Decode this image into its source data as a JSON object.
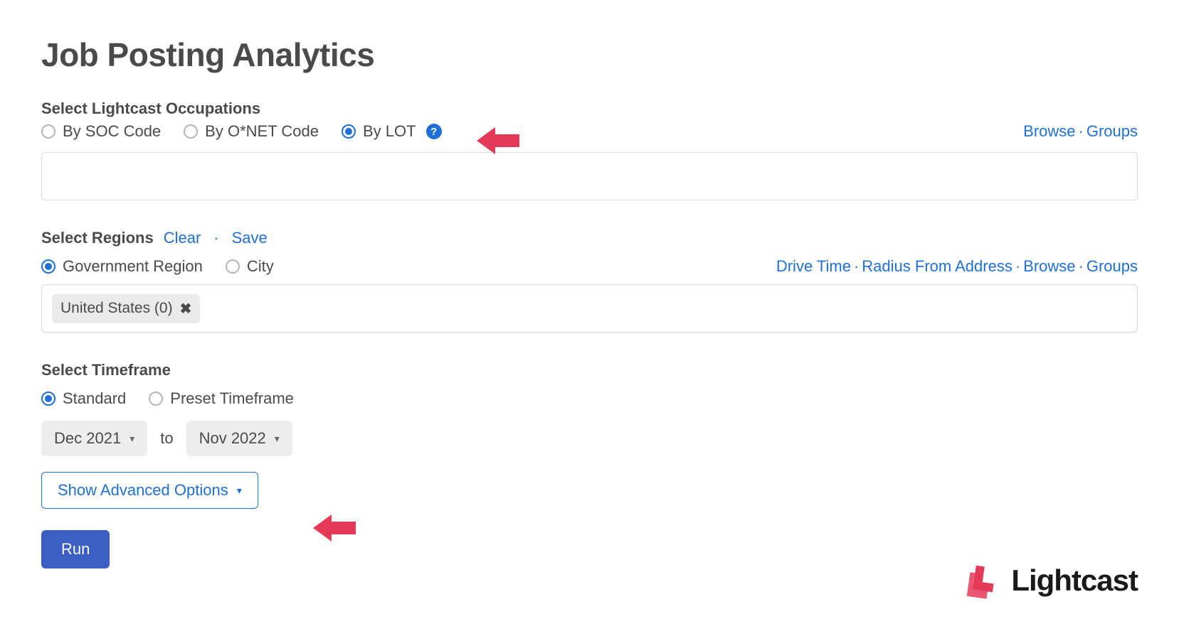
{
  "page_title": "Job Posting Analytics",
  "occupations": {
    "section_label": "Select Lightcast Occupations",
    "radios": {
      "soc": "By SOC Code",
      "onet": "By O*NET Code",
      "lot": "By LOT"
    },
    "selected": "lot",
    "links": {
      "browse": "Browse",
      "groups": "Groups"
    }
  },
  "regions": {
    "section_label": "Select Regions",
    "header_links": {
      "clear": "Clear",
      "save": "Save"
    },
    "radios": {
      "gov": "Government Region",
      "city": "City"
    },
    "selected": "gov",
    "links": {
      "drive": "Drive Time",
      "radius": "Radius From Address",
      "browse": "Browse",
      "groups": "Groups"
    },
    "chip": "United States (0)"
  },
  "timeframe": {
    "section_label": "Select Timeframe",
    "radios": {
      "standard": "Standard",
      "preset": "Preset Timeframe"
    },
    "selected": "standard",
    "from": "Dec 2021",
    "to_word": "to",
    "to": "Nov 2022"
  },
  "advanced_label": "Show Advanced Options",
  "run_label": "Run",
  "brand": "Lightcast"
}
